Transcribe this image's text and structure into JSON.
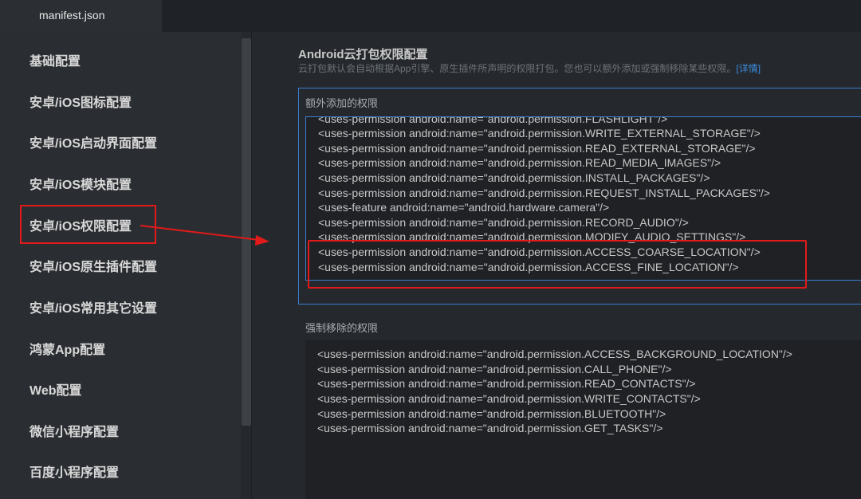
{
  "tab": {
    "label": "manifest.json"
  },
  "sidebar": {
    "items": [
      {
        "label": "基础配置"
      },
      {
        "label": "安卓/iOS图标配置"
      },
      {
        "label": "安卓/iOS启动界面配置"
      },
      {
        "label": "安卓/iOS模块配置"
      },
      {
        "label": "安卓/iOS权限配置"
      },
      {
        "label": "安卓/iOS原生插件配置"
      },
      {
        "label": "安卓/iOS常用其它设置"
      },
      {
        "label": "鸿蒙App配置"
      },
      {
        "label": "Web配置"
      },
      {
        "label": "微信小程序配置"
      },
      {
        "label": "百度小程序配置"
      }
    ]
  },
  "section": {
    "title": "Android云打包权限配置",
    "description": "云打包默认会自动根据App引擎、原生插件所声明的权限打包。您也可以额外添加或强制移除某些权限。",
    "link_text": "[详情]"
  },
  "added": {
    "label": "额外添加的权限",
    "lines": [
      "<uses-permission android:name=\"android.permission.FLASHLIGHT\"/>",
      "<uses-permission android:name=\"android.permission.WRITE_EXTERNAL_STORAGE\"/>",
      "<uses-permission android:name=\"android.permission.READ_EXTERNAL_STORAGE\"/>",
      "<uses-permission android:name=\"android.permission.READ_MEDIA_IMAGES\"/>",
      "<uses-permission android:name=\"android.permission.INSTALL_PACKAGES\"/>",
      "<uses-permission android:name=\"android.permission.REQUEST_INSTALL_PACKAGES\"/>",
      "<uses-feature android:name=\"android.hardware.camera\"/>",
      "<uses-permission android:name=\"android.permission.RECORD_AUDIO\"/>",
      "<uses-permission android:name=\"android.permission.MODIFY_AUDIO_SETTINGS\"/>",
      "<uses-permission android:name=\"android.permission.ACCESS_COARSE_LOCATION\"/>",
      "<uses-permission android:name=\"android.permission.ACCESS_FINE_LOCATION\"/>"
    ]
  },
  "removed": {
    "label": "强制移除的权限",
    "lines": [
      "<uses-permission android:name=\"android.permission.ACCESS_BACKGROUND_LOCATION\"/>",
      "<uses-permission android:name=\"android.permission.CALL_PHONE\"/>",
      "<uses-permission android:name=\"android.permission.READ_CONTACTS\"/>",
      "<uses-permission android:name=\"android.permission.WRITE_CONTACTS\"/>",
      "<uses-permission android:name=\"android.permission.BLUETOOTH\"/>",
      "<uses-permission android:name=\"android.permission.GET_TASKS\"/>"
    ]
  },
  "colors": {
    "annotation_red": "#e21a1a",
    "focus_blue": "#3b7fd4",
    "link_blue": "#3b8de0"
  }
}
